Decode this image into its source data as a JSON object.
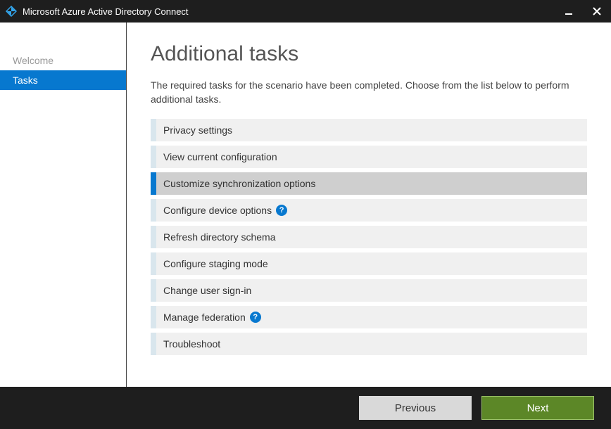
{
  "titlebar": {
    "title": "Microsoft Azure Active Directory Connect"
  },
  "sidebar": {
    "items": [
      {
        "label": "Welcome",
        "active": false
      },
      {
        "label": "Tasks",
        "active": true
      }
    ]
  },
  "main": {
    "heading": "Additional tasks",
    "description": "The required tasks for the scenario have been completed. Choose from the list below to perform additional tasks.",
    "tasks": [
      {
        "label": "Privacy settings",
        "selected": false,
        "help": false
      },
      {
        "label": "View current configuration",
        "selected": false,
        "help": false
      },
      {
        "label": "Customize synchronization options",
        "selected": true,
        "help": false
      },
      {
        "label": "Configure device options",
        "selected": false,
        "help": true
      },
      {
        "label": "Refresh directory schema",
        "selected": false,
        "help": false
      },
      {
        "label": "Configure staging mode",
        "selected": false,
        "help": false
      },
      {
        "label": "Change user sign-in",
        "selected": false,
        "help": false
      },
      {
        "label": "Manage federation",
        "selected": false,
        "help": true
      },
      {
        "label": "Troubleshoot",
        "selected": false,
        "help": false
      }
    ]
  },
  "footer": {
    "previous": "Previous",
    "next": "Next"
  },
  "help_glyph": "?"
}
